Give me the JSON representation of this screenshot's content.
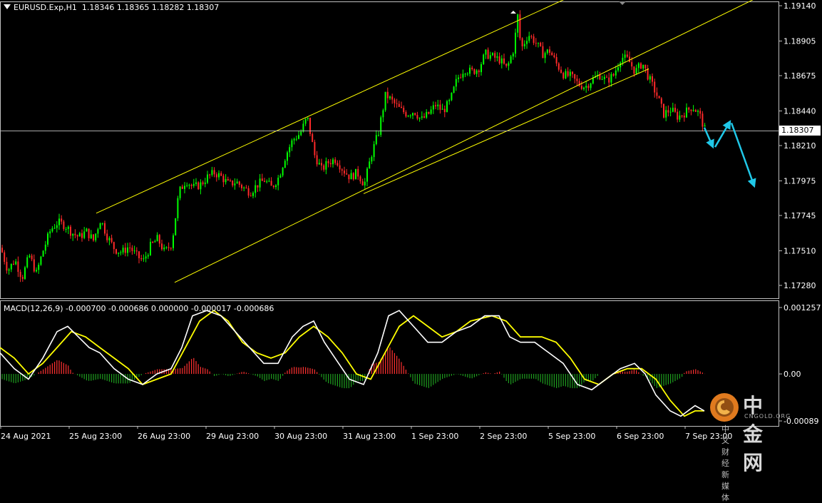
{
  "header": {
    "symbol": "EURUSD.Exp,H1",
    "ohlc": "1.18346 1.18365 1.18282 1.18307"
  },
  "macd_header": "MACD(12,26,9) -0.000700 -0.000686 0.000000 -0.000017 -0.000686",
  "current_price": "1.18307",
  "price_axis": [
    "1.19140",
    "1.18905",
    "1.18675",
    "1.18440",
    "1.18210",
    "1.17975",
    "1.17745",
    "1.17510",
    "1.17280"
  ],
  "macd_axis": [
    "0.001257",
    "0.00",
    "-0.00089"
  ],
  "time_axis": [
    "24 Aug 2021",
    "25 Aug 23:00",
    "26 Aug 23:00",
    "29 Aug 23:00",
    "30 Aug 23:00",
    "31 Aug 23:00",
    "1 Sep 23:00",
    "2 Sep 23:00",
    "5 Sep 23:00",
    "6 Sep 23:00",
    "7 Sep 23:00"
  ],
  "watermark": {
    "main": "中金网",
    "sub": "CNGOLD.ORG",
    "cn": "中文财经新媒体"
  },
  "colors": {
    "bull": "#00ff00",
    "bear": "#ff2a2a",
    "channel": "#ffff00",
    "arrow": "#20c8e8",
    "macd_main": "#ffffff",
    "macd_signal": "#ffff00",
    "hist_pos": "#ff3030",
    "hist_neg": "#1e9e1e",
    "grid": "#c0c0c0"
  },
  "chart_data": [
    {
      "type": "candlestick",
      "title": "EURUSD.Exp,H1",
      "ylim": [
        1.1715,
        1.1918
      ],
      "x_labels": [
        "24 Aug 2021",
        "25 Aug 23:00",
        "26 Aug 23:00",
        "29 Aug 23:00",
        "30 Aug 23:00",
        "31 Aug 23:00",
        "1 Sep 23:00",
        "2 Sep 23:00",
        "5 Sep 23:00",
        "6 Sep 23:00",
        "7 Sep 23:00"
      ],
      "close_path": [
        [
          0,
          1.1753
        ],
        [
          10,
          1.1738
        ],
        [
          20,
          1.1745
        ],
        [
          30,
          1.1733
        ],
        [
          40,
          1.1748
        ],
        [
          50,
          1.1736
        ],
        [
          60,
          1.1752
        ],
        [
          70,
          1.1765
        ],
        [
          80,
          1.177
        ],
        [
          90,
          1.1768
        ],
        [
          100,
          1.1763
        ],
        [
          110,
          1.176
        ],
        [
          120,
          1.1764
        ],
        [
          130,
          1.1758
        ],
        [
          140,
          1.1772
        ],
        [
          150,
          1.176
        ],
        [
          160,
          1.1752
        ],
        [
          170,
          1.175
        ],
        [
          180,
          1.1754
        ],
        [
          190,
          1.1748
        ],
        [
          200,
          1.1744
        ],
        [
          210,
          1.1754
        ],
        [
          220,
          1.1759
        ],
        [
          230,
          1.175
        ],
        [
          240,
          1.1756
        ],
        [
          250,
          1.179
        ],
        [
          260,
          1.1798
        ],
        [
          270,
          1.1793
        ],
        [
          280,
          1.1795
        ],
        [
          290,
          1.18
        ],
        [
          300,
          1.1803
        ],
        [
          310,
          1.18
        ],
        [
          320,
          1.1795
        ],
        [
          330,
          1.1797
        ],
        [
          340,
          1.1793
        ],
        [
          350,
          1.179
        ],
        [
          360,
          1.1795
        ],
        [
          370,
          1.1798
        ],
        [
          380,
          1.1793
        ],
        [
          390,
          1.18
        ],
        [
          400,
          1.1815
        ],
        [
          410,
          1.1825
        ],
        [
          420,
          1.1829
        ],
        [
          430,
          1.184
        ],
        [
          440,
          1.1815
        ],
        [
          450,
          1.1805
        ],
        [
          460,
          1.181
        ],
        [
          470,
          1.1812
        ],
        [
          480,
          1.1805
        ],
        [
          490,
          1.18
        ],
        [
          500,
          1.1803
        ],
        [
          510,
          1.1795
        ],
        [
          520,
          1.1815
        ],
        [
          530,
          1.183
        ],
        [
          540,
          1.1855
        ],
        [
          550,
          1.185
        ],
        [
          560,
          1.1845
        ],
        [
          570,
          1.1842
        ],
        [
          580,
          1.1844
        ],
        [
          590,
          1.1838
        ],
        [
          600,
          1.1842
        ],
        [
          610,
          1.1848
        ],
        [
          620,
          1.1844
        ],
        [
          630,
          1.185
        ],
        [
          640,
          1.1865
        ],
        [
          650,
          1.1872
        ],
        [
          660,
          1.187
        ],
        [
          670,
          1.1872
        ],
        [
          680,
          1.1882
        ],
        [
          690,
          1.188
        ],
        [
          700,
          1.1878
        ],
        [
          710,
          1.1872
        ],
        [
          720,
          1.1886
        ],
        [
          725,
          1.1908
        ],
        [
          730,
          1.1885
        ],
        [
          740,
          1.1895
        ],
        [
          750,
          1.189
        ],
        [
          760,
          1.1882
        ],
        [
          770,
          1.1884
        ],
        [
          780,
          1.1875
        ],
        [
          790,
          1.1868
        ],
        [
          800,
          1.1867
        ],
        [
          810,
          1.1862
        ],
        [
          820,
          1.186
        ],
        [
          830,
          1.1865
        ],
        [
          840,
          1.1868
        ],
        [
          850,
          1.1864
        ],
        [
          860,
          1.1868
        ],
        [
          870,
          1.188
        ],
        [
          880,
          1.1878
        ],
        [
          890,
          1.187
        ],
        [
          900,
          1.1876
        ],
        [
          910,
          1.1865
        ],
        [
          920,
          1.1855
        ],
        [
          930,
          1.1842
        ],
        [
          940,
          1.1845
        ],
        [
          950,
          1.184
        ],
        [
          960,
          1.1843
        ],
        [
          970,
          1.1847
        ],
        [
          980,
          1.1842
        ],
        [
          988,
          1.1831
        ]
      ],
      "channel": {
        "upper": [
          [
            135,
            1.1776
          ],
          [
            800,
            1.192
          ]
        ],
        "lower": [
          [
            245,
            1.173
          ],
          [
            1065,
            1.192
          ]
        ],
        "mid_break": [
          [
            510,
            1.1789
          ],
          [
            910,
            1.1872
          ]
        ]
      },
      "projection_arrows": [
        [
          [
            988,
            1.1833
          ],
          [
            1000,
            1.182
          ]
        ],
        [
          [
            1003,
            1.182
          ],
          [
            1024,
            1.1837
          ]
        ],
        [
          [
            1026,
            1.1836
          ],
          [
            1058,
            1.1794
          ]
        ]
      ]
    },
    {
      "type": "line",
      "title": "MACD(12,26,9)",
      "ylim": [
        -0.00089,
        0.001257
      ],
      "series": [
        {
          "name": "main",
          "points": [
            [
              0,
              0.0004
            ],
            [
              20,
              0.0001
            ],
            [
              40,
              -0.0001
            ],
            [
              60,
              0.0003
            ],
            [
              80,
              0.0008
            ],
            [
              95,
              0.0009
            ],
            [
              110,
              0.0007
            ],
            [
              125,
              0.0005
            ],
            [
              140,
              0.0004
            ],
            [
              160,
              0.0001
            ],
            [
              180,
              -0.0001
            ],
            [
              200,
              -0.0002
            ],
            [
              220,
              0.0
            ],
            [
              240,
              0.0001
            ],
            [
              255,
              0.0005
            ],
            [
              270,
              0.0011
            ],
            [
              290,
              0.0012
            ],
            [
              310,
              0.0011
            ],
            [
              330,
              0.0008
            ],
            [
              350,
              0.0005
            ],
            [
              370,
              0.0002
            ],
            [
              390,
              0.0002
            ],
            [
              410,
              0.0007
            ],
            [
              425,
              0.0009
            ],
            [
              440,
              0.001
            ],
            [
              455,
              0.0006
            ],
            [
              470,
              0.0003
            ],
            [
              490,
              -0.0001
            ],
            [
              510,
              -0.0002
            ],
            [
              530,
              0.0004
            ],
            [
              545,
              0.0011
            ],
            [
              560,
              0.0012
            ],
            [
              580,
              0.0009
            ],
            [
              600,
              0.0006
            ],
            [
              620,
              0.0006
            ],
            [
              640,
              0.0008
            ],
            [
              660,
              0.0009
            ],
            [
              680,
              0.0011
            ],
            [
              700,
              0.0011
            ],
            [
              715,
              0.0007
            ],
            [
              730,
              0.0006
            ],
            [
              750,
              0.0006
            ],
            [
              770,
              0.0004
            ],
            [
              790,
              0.0002
            ],
            [
              810,
              -0.0002
            ],
            [
              830,
              -0.0003
            ],
            [
              850,
              -0.0001
            ],
            [
              870,
              0.0001
            ],
            [
              890,
              0.0002
            ],
            [
              905,
              0.0
            ],
            [
              920,
              -0.0004
            ],
            [
              940,
              -0.0007
            ],
            [
              955,
              -0.0008
            ],
            [
              975,
              -0.0006
            ],
            [
              988,
              -0.0007
            ]
          ]
        },
        {
          "name": "signal",
          "points": [
            [
              0,
              0.0005
            ],
            [
              20,
              0.0003
            ],
            [
              40,
              0.0
            ],
            [
              60,
              0.0002
            ],
            [
              80,
              0.0005
            ],
            [
              100,
              0.0008
            ],
            [
              120,
              0.0007
            ],
            [
              140,
              0.0005
            ],
            [
              160,
              0.0003
            ],
            [
              180,
              0.0001
            ],
            [
              200,
              -0.0002
            ],
            [
              220,
              -0.0001
            ],
            [
              240,
              0.0
            ],
            [
              260,
              0.0005
            ],
            [
              280,
              0.001
            ],
            [
              300,
              0.0012
            ],
            [
              320,
              0.001
            ],
            [
              340,
              0.0006
            ],
            [
              360,
              0.0004
            ],
            [
              380,
              0.0003
            ],
            [
              400,
              0.0004
            ],
            [
              420,
              0.0007
            ],
            [
              440,
              0.0009
            ],
            [
              460,
              0.0007
            ],
            [
              480,
              0.0004
            ],
            [
              500,
              0.0
            ],
            [
              520,
              -0.0001
            ],
            [
              540,
              0.0004
            ],
            [
              560,
              0.0009
            ],
            [
              580,
              0.0011
            ],
            [
              600,
              0.0009
            ],
            [
              620,
              0.0007
            ],
            [
              640,
              0.0008
            ],
            [
              660,
              0.001
            ],
            [
              690,
              0.0011
            ],
            [
              710,
              0.001
            ],
            [
              730,
              0.0007
            ],
            [
              760,
              0.0007
            ],
            [
              780,
              0.0006
            ],
            [
              800,
              0.0003
            ],
            [
              820,
              -0.0001
            ],
            [
              840,
              -0.0002
            ],
            [
              860,
              0.0
            ],
            [
              880,
              0.0001
            ],
            [
              900,
              0.0001
            ],
            [
              920,
              -0.0001
            ],
            [
              940,
              -0.0005
            ],
            [
              960,
              -0.0008
            ],
            [
              975,
              -0.0007
            ],
            [
              988,
              -0.0007
            ]
          ]
        }
      ]
    }
  ]
}
